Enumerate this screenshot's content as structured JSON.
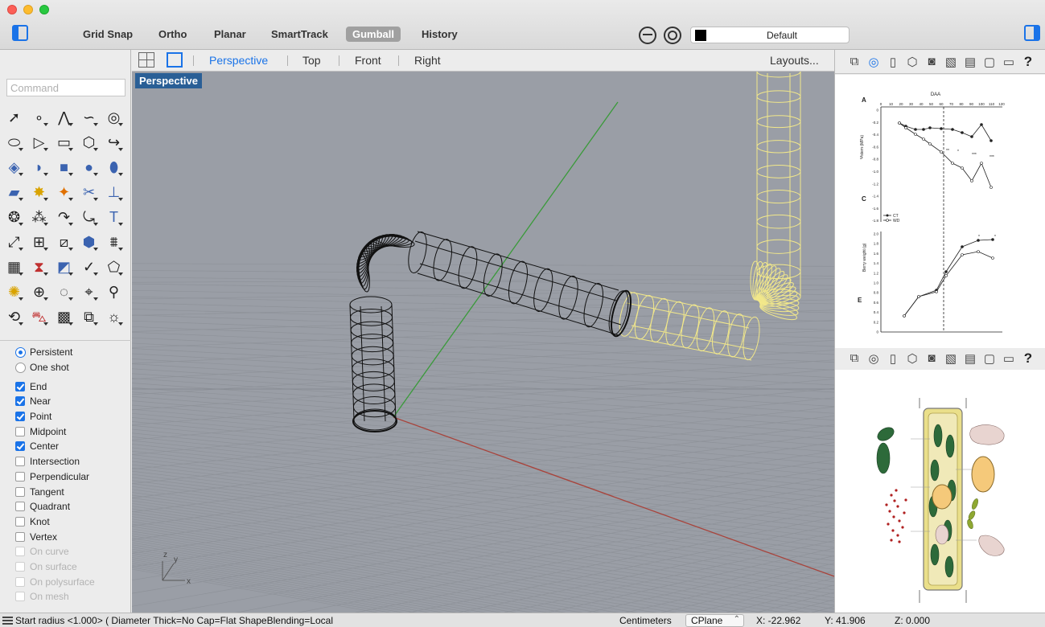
{
  "toolbar": {
    "toggles": [
      {
        "label": "Grid Snap",
        "active": false
      },
      {
        "label": "Ortho",
        "active": false
      },
      {
        "label": "Planar",
        "active": false
      },
      {
        "label": "SmartTrack",
        "active": false
      },
      {
        "label": "Gumball",
        "active": true
      },
      {
        "label": "History",
        "active": false
      }
    ],
    "layer": {
      "name": "Default",
      "color": "#000000"
    }
  },
  "command": {
    "placeholder": "Command"
  },
  "tools": [
    "arrow-icon",
    "point-icon",
    "polyline-icon",
    "curve-icon",
    "circle-icon",
    "ellipse-icon",
    "polygon-icon",
    "rectangle-icon",
    "arc-icon",
    "fillet-icon",
    "surface-icon",
    "sweep-icon",
    "box-icon",
    "sphere-icon",
    "cylinder-icon",
    "plane-icon",
    "gear-icon",
    "explode-icon",
    "trim-icon",
    "split-icon",
    "boolean-icon",
    "group-icon",
    "join-icon",
    "offset-icon",
    "text-icon",
    "move-icon",
    "array-icon",
    "transform-icon",
    "solid-edit-icon",
    "mesh-icon",
    "grid-icon",
    "cage-icon",
    "shade-icon",
    "check-icon",
    "analyze-icon",
    "sun-icon",
    "zoom-icon",
    "lasso-icon",
    "fit-icon",
    "search-icon",
    "rotate-icon",
    "car-icon",
    "texture-icon",
    "layers-icon",
    "light-icon"
  ],
  "osnap": {
    "modes": [
      {
        "label": "Persistent",
        "selected": true
      },
      {
        "label": "One shot",
        "selected": false
      }
    ],
    "items": [
      {
        "label": "End",
        "checked": true,
        "enabled": true
      },
      {
        "label": "Near",
        "checked": true,
        "enabled": true
      },
      {
        "label": "Point",
        "checked": true,
        "enabled": true
      },
      {
        "label": "Midpoint",
        "checked": false,
        "enabled": true
      },
      {
        "label": "Center",
        "checked": true,
        "enabled": true
      },
      {
        "label": "Intersection",
        "checked": false,
        "enabled": true
      },
      {
        "label": "Perpendicular",
        "checked": false,
        "enabled": true
      },
      {
        "label": "Tangent",
        "checked": false,
        "enabled": true
      },
      {
        "label": "Quadrant",
        "checked": false,
        "enabled": true
      },
      {
        "label": "Knot",
        "checked": false,
        "enabled": true
      },
      {
        "label": "Vertex",
        "checked": false,
        "enabled": true
      },
      {
        "label": "On curve",
        "checked": false,
        "enabled": false
      },
      {
        "label": "On surface",
        "checked": false,
        "enabled": false
      },
      {
        "label": "On polysurface",
        "checked": false,
        "enabled": false
      },
      {
        "label": "On mesh",
        "checked": false,
        "enabled": false
      }
    ]
  },
  "viewport_tabs": {
    "tabs": [
      "Perspective",
      "Top",
      "Front",
      "Right"
    ],
    "active": "Perspective",
    "layouts_label": "Layouts..."
  },
  "viewport": {
    "label": "Perspective",
    "axis_labels": {
      "x": "x",
      "y": "y",
      "z": "z"
    },
    "colors": {
      "background": "#9a9ea6",
      "x_axis": "#a8443c",
      "y_axis": "#3a9a3a",
      "selected": "#f2e88a",
      "wire": "#111111"
    }
  },
  "panels": {
    "tab_icons": [
      "layers-icon",
      "display-icon",
      "properties-icon",
      "object-icon",
      "render-icon",
      "materials-icon",
      "notes-icon",
      "blank-icon",
      "monitor-icon",
      "help-icon"
    ],
    "help_label": "?",
    "chart": {
      "title": "DAA",
      "panel_a_label": "A",
      "panel_c_label": "C",
      "panel_e_label": "E",
      "top_ticks": [
        "0",
        "10",
        "20",
        "30",
        "40",
        "50",
        "60",
        "70",
        "80",
        "90",
        "100",
        "110",
        "120"
      ],
      "a_yticks": [
        "0",
        "-0.2",
        "-0.4",
        "-0.6",
        "-0.8",
        "-1.0",
        "-1.2",
        "-1.4",
        "-1.6",
        "-1.8"
      ],
      "a_ylabel": "Ψstem (MPa)",
      "legend": [
        "CT",
        "WD"
      ],
      "c_yticks": [
        "2.0",
        "1.8",
        "1.6",
        "1.4",
        "1.2",
        "1.0",
        "0.8",
        "0.6",
        "0.4",
        "0.2",
        "0"
      ],
      "c_ylabel": "Berry weight (g)",
      "sig_marks": [
        "**",
        "*",
        "***",
        "***",
        "*",
        "*"
      ]
    }
  },
  "status": {
    "prompt": "Start radius <1.000> ( Diameter Thick=No Cap=Flat ShapeBlending=Local",
    "units": "Centimeters",
    "cplane": "CPlane",
    "x": "X: -22.962",
    "y": "Y: 41.906",
    "z": "Z: 0.000"
  }
}
